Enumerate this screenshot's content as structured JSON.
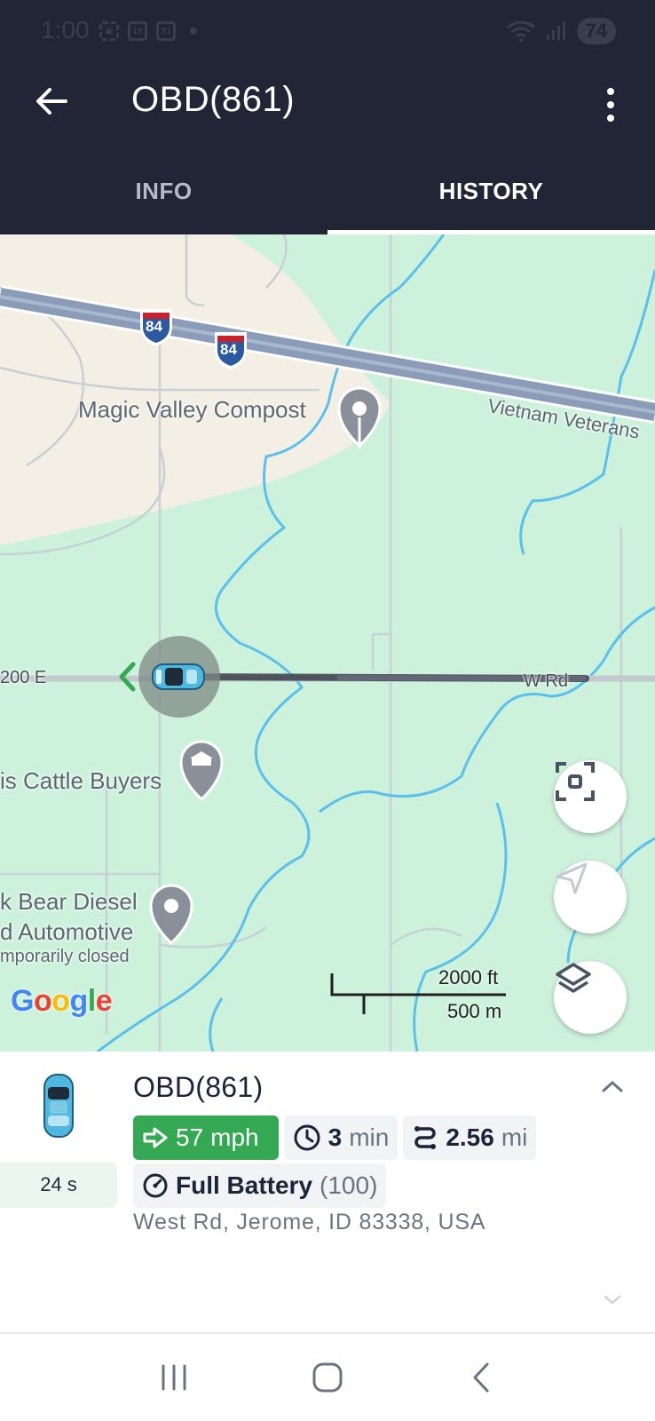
{
  "status_bar": {
    "time": "1:00",
    "icons_left": [
      "screenshot-icon",
      "calendar-icon",
      "calendar-icon"
    ],
    "calendar_1": "19",
    "calendar_2": "31",
    "icons_right": [
      "wifi-icon",
      "signal-icon"
    ],
    "wifi_badge": "5",
    "battery": "74"
  },
  "app_bar": {
    "title": "OBD(861)",
    "back_icon": "arrow-left-icon",
    "menu_icon": "more-vertical-icon"
  },
  "tabs": [
    {
      "label": "INFO",
      "active": false
    },
    {
      "label": "HISTORY",
      "active": true
    }
  ],
  "map": {
    "labels": {
      "compost": "Magic Valley Compost",
      "cattle": "is Cattle Buyers",
      "diesel_line1": "k Bear Diesel",
      "diesel_line2": "d Automotive",
      "diesel_status": "mporarily closed",
      "road_left": "200 E",
      "road_right": "W Rd",
      "highway_name": "Vietnam Veterans",
      "interstate_1": "84",
      "interstate_2": "84"
    },
    "attribution": "Google",
    "scale": {
      "imperial": "2000 ft",
      "metric": "500 m"
    },
    "buttons": {
      "fit": "fit-bounds-icon",
      "locate": "navigation-arrow-icon",
      "layers": "layers-icon"
    },
    "colors": {
      "park": "#cdf2dc",
      "land": "#f3efe4",
      "river": "#5bc0eb",
      "highway": "#8a9cb8",
      "route": "#3a3f4a",
      "start_marker": "#34a853"
    }
  },
  "vehicle_panel": {
    "name": "OBD(861)",
    "duration": "24 s",
    "speed_value": "57",
    "speed_unit": "mph",
    "time_value": "3",
    "time_unit": "min",
    "distance_value": "2.56",
    "distance_unit": "mi",
    "battery_label": "Full Battery",
    "battery_value": "(100)",
    "address": "West Rd, Jerome, ID 83338, USA",
    "colors": {
      "speed_chip": "#34a853",
      "vehicle": "#4fb8df"
    }
  },
  "nav_bar": {
    "buttons": [
      "recent-apps-icon",
      "home-icon",
      "back-icon"
    ]
  }
}
